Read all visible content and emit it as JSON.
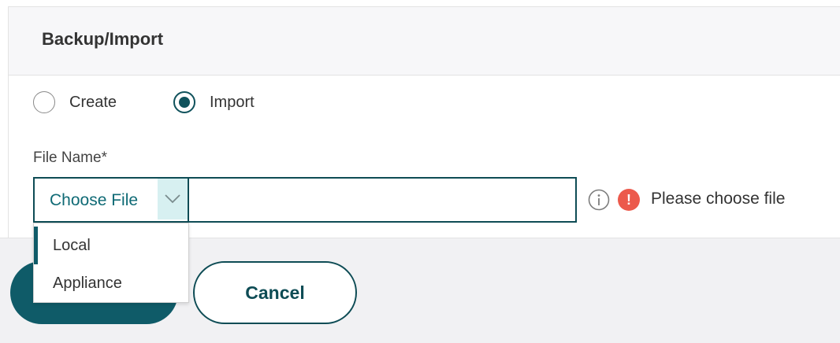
{
  "panel": {
    "title": "Backup/Import"
  },
  "mode": {
    "options": [
      {
        "label": "Create",
        "checked": false
      },
      {
        "label": "Import",
        "checked": true
      }
    ]
  },
  "file_name": {
    "label": "File Name*",
    "choose_label": "Choose File",
    "value": "",
    "error": "Please choose file",
    "dropdown": {
      "items": [
        {
          "label": "Local",
          "selected": true
        },
        {
          "label": "Appliance",
          "selected": false
        }
      ]
    }
  },
  "buttons": {
    "cancel": "Cancel"
  },
  "colors": {
    "accent": "#0f5b68",
    "accent_light": "#d7f0f1",
    "error": "#ec5a4c"
  }
}
